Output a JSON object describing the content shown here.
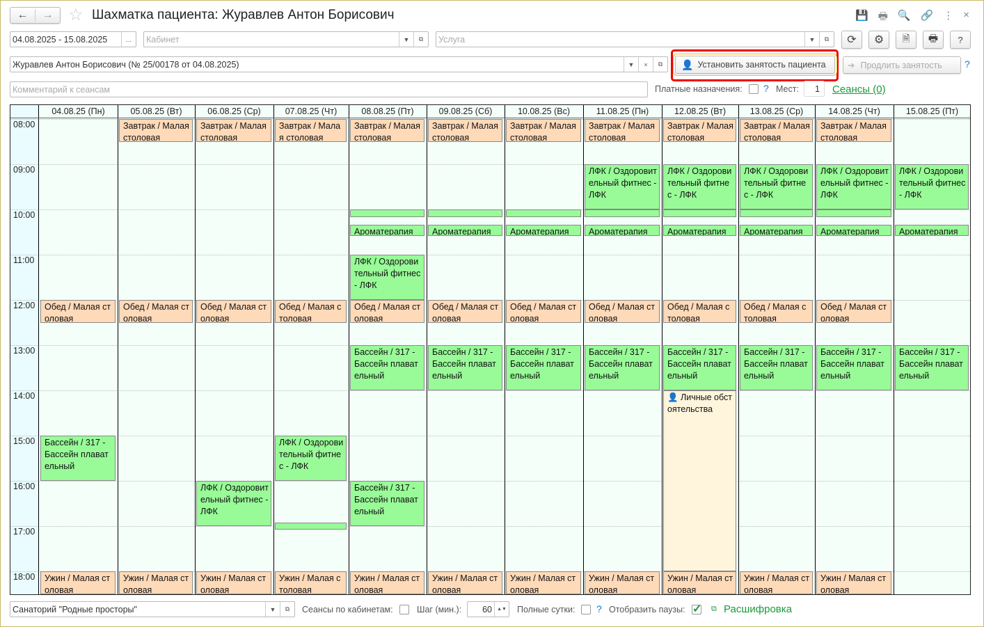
{
  "window": {
    "title": "Шахматка пациента: Журавлев Антон Борисович",
    "header_icons": [
      "save-icon",
      "print-icon",
      "preview-icon",
      "link-icon",
      "more-icon",
      "close-icon"
    ],
    "close": "×",
    "more": "⋮"
  },
  "filters": {
    "period": "04.08.2025 - 15.08.2025",
    "period_btn": "...",
    "cabinet_placeholder": "Кабинет",
    "service_placeholder": "Услуга",
    "patient": "Журавлев Антон Борисович (№ 25/00178 от 04.08.2025)",
    "comment_placeholder": "Комментарий к сеансам",
    "paid_label": "Платные назначения:",
    "places_label": "Мест:",
    "places_value": "1",
    "sessions_link": "Сеансы (0)",
    "help": "?"
  },
  "toolbar": {
    "set_busy": "Установить занятость пациента",
    "extend_busy": "Продлить занятость",
    "help": "?"
  },
  "grid": {
    "days": [
      "04.08.25 (Пн)",
      "05.08.25 (Вт)",
      "06.08.25 (Ср)",
      "07.08.25 (Чт)",
      "08.08.25 (Пт)",
      "09.08.25 (Сб)",
      "10.08.25 (Вс)",
      "11.08.25 (Пн)",
      "12.08.25 (Вт)",
      "13.08.25 (Ср)",
      "14.08.25 (Чт)",
      "15.08.25 (Пт)"
    ],
    "hours": [
      "08:00",
      "09:00",
      "10:00",
      "11:00",
      "12:00",
      "13:00",
      "14:00",
      "15:00",
      "16:00",
      "17:00",
      "18:00"
    ],
    "types": {
      "breakfast": {
        "text": "Завтрак / Малая столовая",
        "color": "#ffdab9"
      },
      "lunch": {
        "text": "Обед / Малая столовая",
        "color": "#ffdab9"
      },
      "supper": {
        "text": "Ужин / Малая столовая",
        "color": "#ffdab9"
      },
      "lfk": {
        "text": "ЛФК / Оздоровительный фитнес - ЛФК",
        "color": "#98fb98"
      },
      "aroma": {
        "text": "Ароматерапия",
        "color": "#98fb98"
      },
      "pool": {
        "text": "Бассейн / 317 - Бассейн плавательный",
        "color": "#98fb98"
      },
      "short": {
        "text": "",
        "color": "#98fb98"
      },
      "personal": {
        "text": "Личные обстоятельства",
        "color": "#fff5dc"
      }
    },
    "events": [
      {
        "type": "breakfast",
        "days": [
          1,
          2,
          3,
          4,
          5,
          6,
          7,
          8,
          9,
          10
        ],
        "start": "08:00",
        "end": "08:30"
      },
      {
        "type": "lfk",
        "days": [
          7,
          8,
          9,
          10,
          11
        ],
        "start": "09:00",
        "end": "10:00"
      },
      {
        "type": "short",
        "days": [
          4,
          5,
          6,
          7,
          8,
          9,
          10
        ],
        "start": "10:00",
        "end": "10:10"
      },
      {
        "type": "aroma",
        "days": [
          4,
          5,
          6,
          7,
          8,
          9,
          10,
          11
        ],
        "start": "10:20",
        "end": "10:35"
      },
      {
        "type": "lfk",
        "days": [
          4
        ],
        "start": "11:00",
        "end": "12:00"
      },
      {
        "type": "lunch",
        "days": [
          0,
          1,
          2,
          3,
          4,
          5,
          6,
          7,
          8,
          9,
          10
        ],
        "start": "12:00",
        "end": "12:30"
      },
      {
        "type": "pool",
        "days": [
          4,
          5,
          6,
          7,
          8,
          9,
          10,
          11
        ],
        "start": "13:00",
        "end": "14:00"
      },
      {
        "type": "personal",
        "days": [
          8
        ],
        "start": "14:00",
        "end": "18:00"
      },
      {
        "type": "pool",
        "days": [
          0
        ],
        "start": "15:00",
        "end": "16:00"
      },
      {
        "type": "lfk",
        "days": [
          3
        ],
        "start": "15:00",
        "end": "16:00"
      },
      {
        "type": "lfk",
        "days": [
          2
        ],
        "start": "16:00",
        "end": "17:00"
      },
      {
        "type": "pool",
        "days": [
          4
        ],
        "start": "16:00",
        "end": "17:00"
      },
      {
        "type": "short",
        "days": [
          3
        ],
        "start": "16:55",
        "end": "17:05"
      },
      {
        "type": "supper",
        "days": [
          0,
          1,
          2,
          3,
          4,
          5,
          6,
          7,
          8,
          9,
          10
        ],
        "start": "18:00",
        "end": "18:30"
      }
    ]
  },
  "footer": {
    "org": "Санаторий \"Родные просторы\"",
    "by_cabinet_label": "Сеансы по кабинетам:",
    "step_label": "Шаг (мин.):",
    "step_value": "60",
    "full_day_label": "Полные сутки:",
    "help": "?",
    "show_pauses_label": "Отобразить паузы:",
    "show_pauses_checked": true,
    "legend_link": "Расшифровка"
  }
}
